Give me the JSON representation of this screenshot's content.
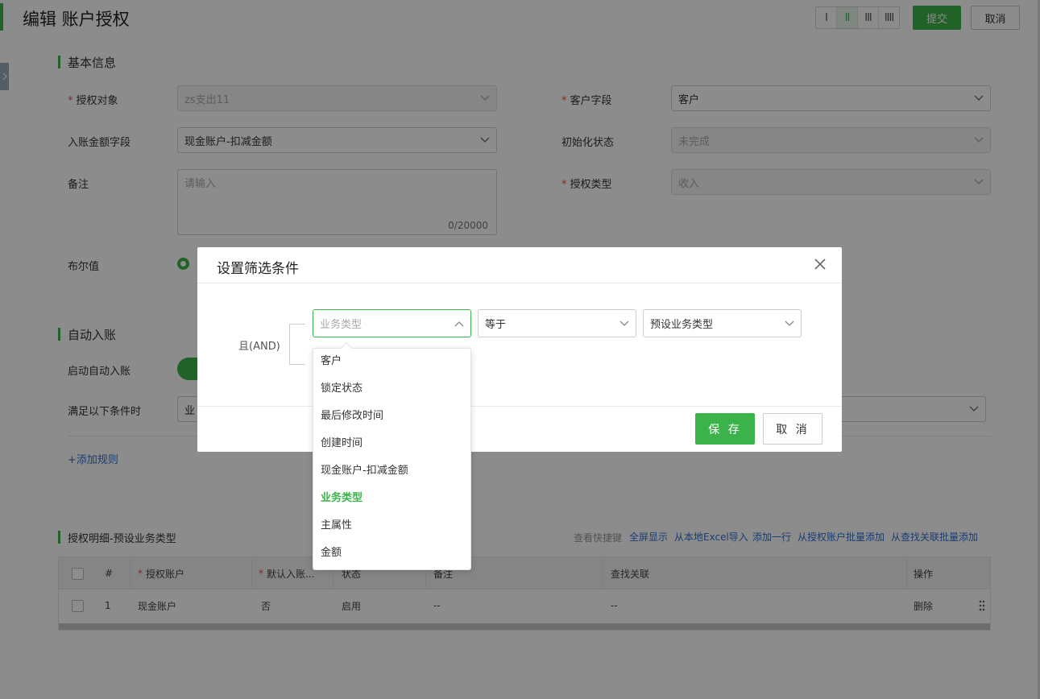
{
  "header": {
    "title": "编辑 账户授权",
    "column_options": [
      "I",
      "II",
      "III",
      "IIII"
    ],
    "column_selected": "II",
    "submit_label": "提交",
    "cancel_label": "取消"
  },
  "basic_info": {
    "section_title": "基本信息",
    "auth_object": {
      "label": "授权对象",
      "value": "zs支出11"
    },
    "customer_field": {
      "label": "客户字段",
      "value": "客户"
    },
    "amount_field": {
      "label": "入账金额字段",
      "value": "现金账户-扣减金额"
    },
    "init_status": {
      "label": "初始化状态",
      "value": "未完成"
    },
    "remark": {
      "label": "备注",
      "placeholder": "请输入",
      "counter": "0/20000"
    },
    "auth_type": {
      "label": "授权类型",
      "value": "收入"
    },
    "boolean": {
      "label": "布尔值"
    }
  },
  "auto_entry": {
    "section_title": "自动入账",
    "enable_label": "启动自动入账",
    "condition_label": "满足以下条件时",
    "condition_partial": "业",
    "add_rule_link": "+添加规则"
  },
  "detail": {
    "section_title": "授权明细-预设业务类型",
    "actions": [
      "查看快捷键",
      "全屏显示",
      "从本地Excel导入",
      "添加一行",
      "从授权账户批量添加",
      "从查找关联批量添加"
    ],
    "columns": [
      "#",
      "授权账户",
      "默认入账...",
      "状态",
      "备注",
      "查找关联",
      "操作"
    ],
    "rows": [
      {
        "index": "1",
        "account": "现金账户",
        "default": "否",
        "status": "启用",
        "remark": "--",
        "lookup": "--",
        "action": "删除"
      }
    ]
  },
  "modal": {
    "title": "设置筛选条件",
    "and_label": "且(AND)",
    "field_placeholder": "业务类型",
    "operator": "等于",
    "value": "预设业务类型",
    "save_label": "保 存",
    "cancel_label": "取 消"
  },
  "dropdown": {
    "items": [
      "客户",
      "锁定状态",
      "最后修改时间",
      "创建时间",
      "现金账户-扣减金额",
      "业务类型",
      "主属性",
      "金额"
    ],
    "selected": "业务类型"
  },
  "colors": {
    "accent": "#3bb34a",
    "link": "#2f6fd1",
    "required": "#e34d4d"
  }
}
